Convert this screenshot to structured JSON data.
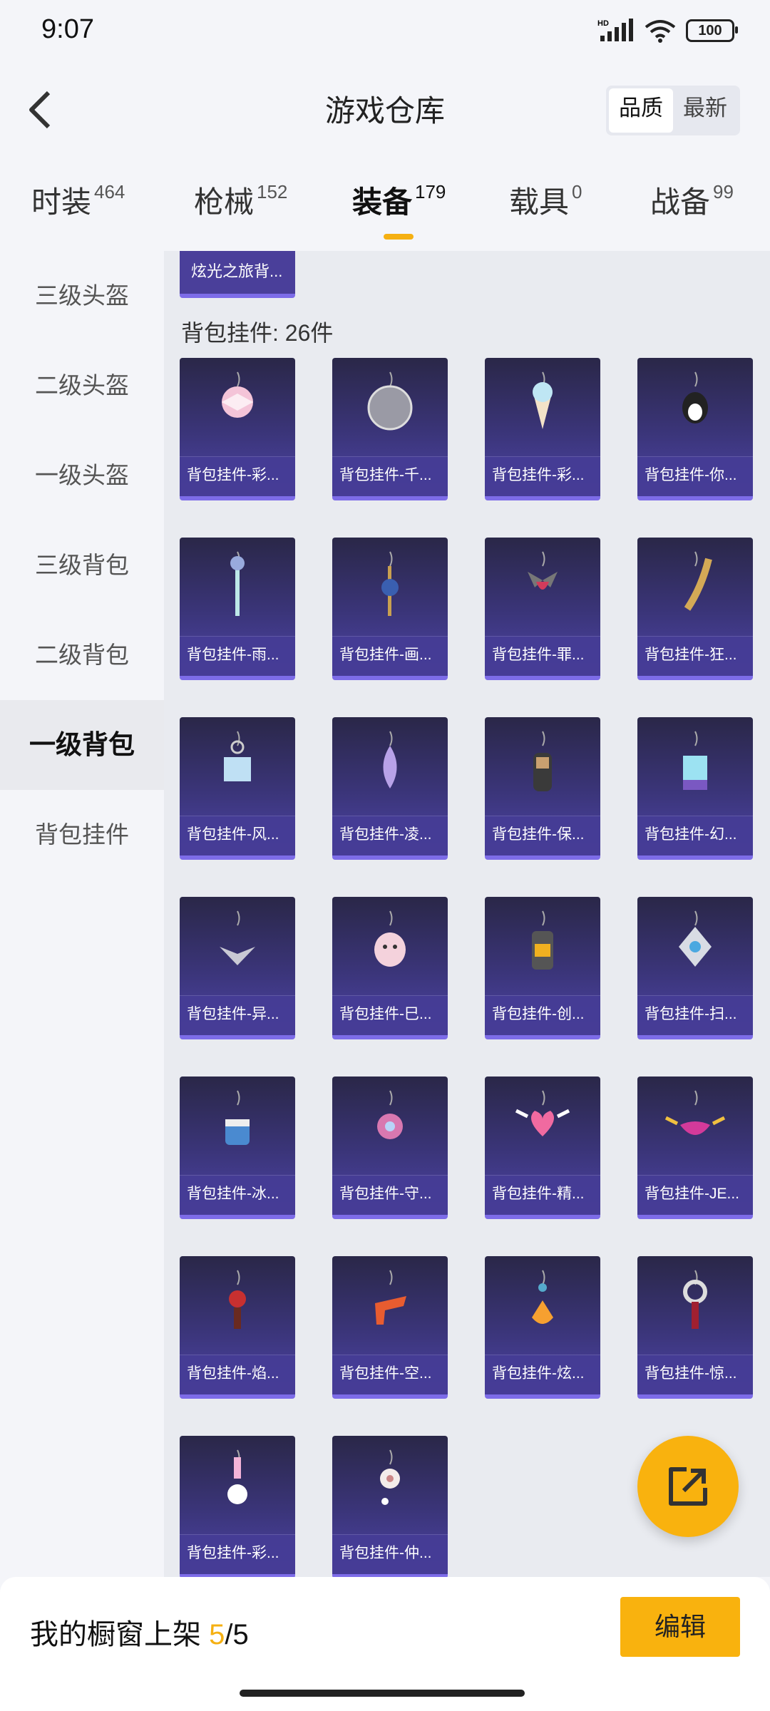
{
  "status": {
    "time": "9:07",
    "battery": "100",
    "network_badge": "HD"
  },
  "header": {
    "title": "游戏仓库",
    "sort_options": [
      "品质",
      "最新"
    ],
    "sort_active": "品质"
  },
  "tabs": [
    {
      "label": "时装",
      "count": "464"
    },
    {
      "label": "枪械",
      "count": "152"
    },
    {
      "label": "装备",
      "count": "179",
      "active": true
    },
    {
      "label": "载具",
      "count": "0"
    },
    {
      "label": "战备",
      "count": "99"
    }
  ],
  "sidebar": {
    "items": [
      "三级头盔",
      "二级头盔",
      "一级头盔",
      "三级背包",
      "二级背包",
      "一级背包",
      "背包挂件"
    ],
    "active": "一级背包"
  },
  "content": {
    "top_card_label": "炫光之旅背...",
    "section_title": "背包挂件: 26件",
    "items": [
      "背包挂件-彩...",
      "背包挂件-千...",
      "背包挂件-彩...",
      "背包挂件-你...",
      "背包挂件-雨...",
      "背包挂件-画...",
      "背包挂件-罪...",
      "背包挂件-狂...",
      "背包挂件-风...",
      "背包挂件-凌...",
      "背包挂件-保...",
      "背包挂件-幻...",
      "背包挂件-异...",
      "背包挂件-巳...",
      "背包挂件-创...",
      "背包挂件-扫...",
      "背包挂件-冰...",
      "背包挂件-守...",
      "背包挂件-精...",
      "背包挂件-JE...",
      "背包挂件-焰...",
      "背包挂件-空...",
      "背包挂件-炫...",
      "背包挂件-惊...",
      "背包挂件-彩...",
      "背包挂件-仲..."
    ]
  },
  "bottom": {
    "prefix": "我的橱窗上架 ",
    "current": "5",
    "total": "/5",
    "edit_label": "编辑"
  },
  "colors": {
    "accent": "#f9b20e",
    "card_bg": "#3b357a",
    "card_border": "#7d6ce8"
  }
}
